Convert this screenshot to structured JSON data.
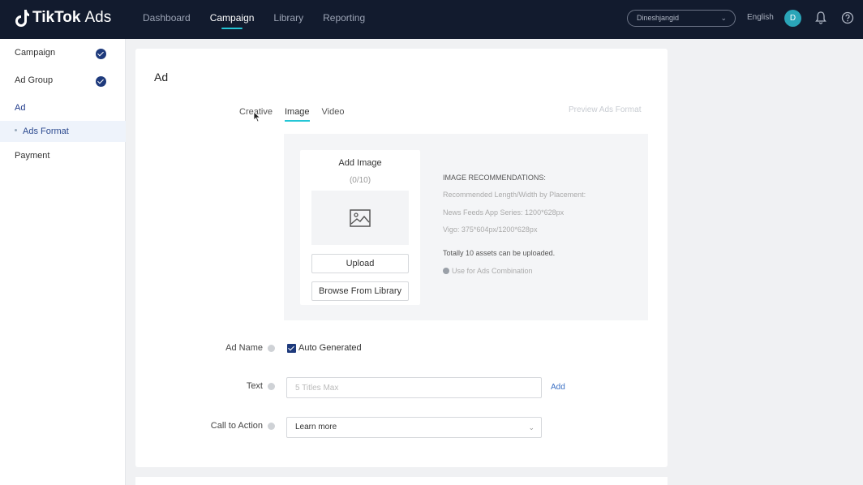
{
  "topbar": {
    "brand": "TikTok",
    "brand_suffix": "Ads",
    "nav": [
      "Dashboard",
      "Campaign",
      "Library",
      "Reporting"
    ],
    "account": "Dineshjangid",
    "language": "English",
    "avatar_initial": "D"
  },
  "sidebar": {
    "campaign": "Campaign",
    "ad_group": "Ad Group",
    "ad": "Ad",
    "ads_format": "Ads Format",
    "payment": "Payment"
  },
  "card": {
    "title": "Ad",
    "tabs": [
      "Creative",
      "Image",
      "Video"
    ],
    "active_tab": "Image",
    "preview_link": "Preview Ads Format",
    "upload": {
      "title": "Add Image",
      "count": "(0/10)",
      "upload_button": "Upload",
      "browse_button": "Browse From Library"
    },
    "recommendations": {
      "heading": "IMAGE RECOMMENDATIONS:",
      "line1": "Recommended Length/Width by Placement:",
      "line2": "News Feeds App Series: 1200*628px",
      "line3": "Vigo: 375*604px/1200*628px",
      "total": "Totally 10 assets can be uploaded.",
      "combo": "Use for Ads Combination"
    },
    "form": {
      "ad_name_label": "Ad Name",
      "auto_generated": "Auto Generated",
      "text_label": "Text",
      "text_placeholder": "5 Titles Max",
      "add": "Add",
      "cta_label": "Call to Action",
      "cta_value": "Learn more"
    }
  },
  "colors": {
    "topbar": "#121b2e",
    "accent": "#25c6d6",
    "primary": "#1e3a7c"
  }
}
